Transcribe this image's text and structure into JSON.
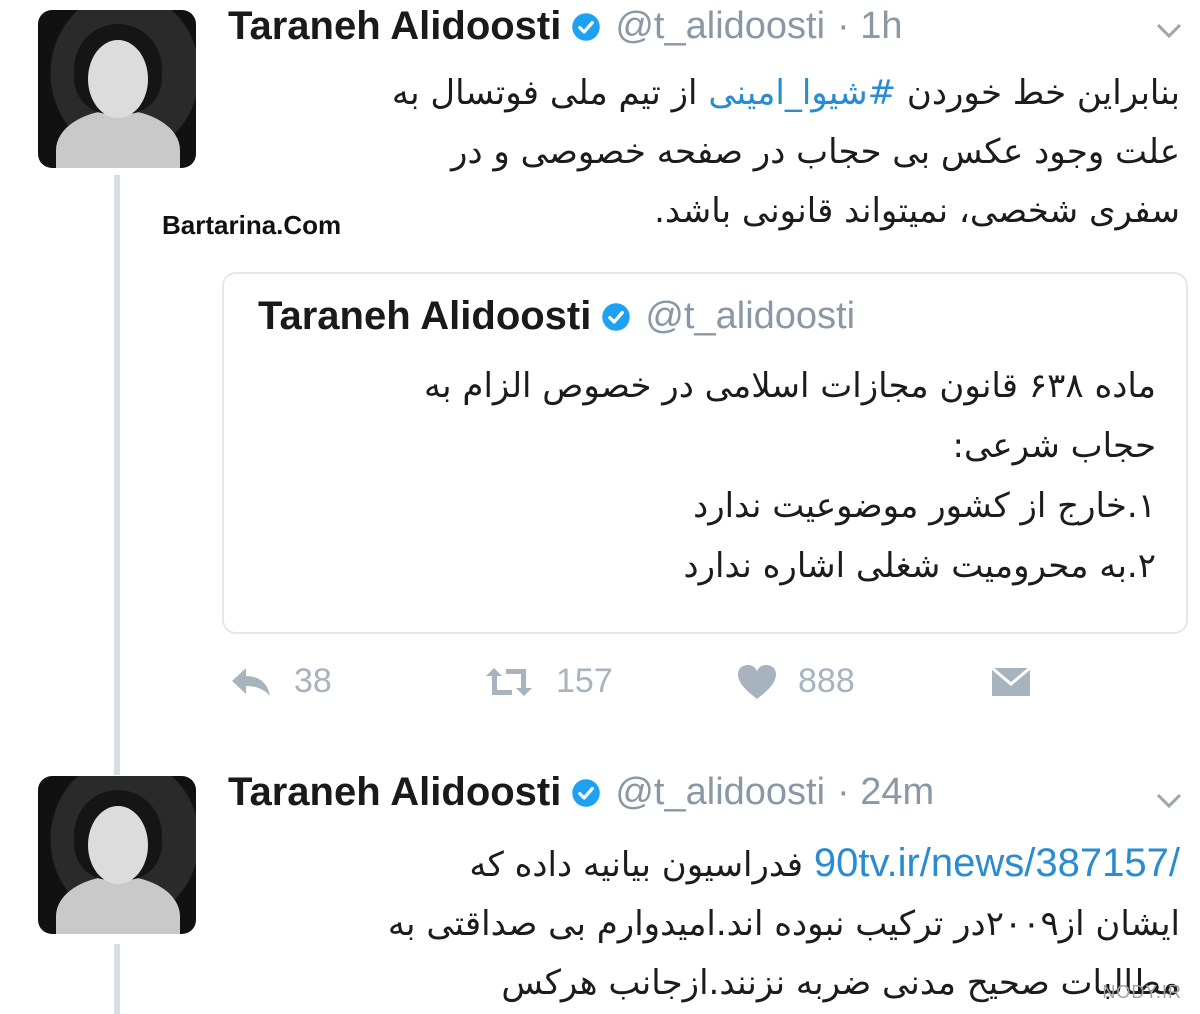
{
  "tweet1": {
    "name": "Taraneh Alidoosti",
    "handle": "@t_alidoosti",
    "time": "· 1h",
    "lines": [
      {
        "before": "بنابراین خط خوردن ",
        "hashtag": "#شیوا_امینی",
        "after": " از تیم ملی فوتسال به"
      },
      {
        "text": "علت وجود عکس بی حجاب در صفحه خصوصی و در"
      },
      {
        "text": "سفری شخصی، نمیتواند قانونی باشد."
      }
    ],
    "watermark": "Bartarina.Com"
  },
  "quoted": {
    "name": "Taraneh Alidoosti",
    "handle": "@t_alidoosti",
    "lines": [
      "ماده ۶۳۸ قانون مجازات اسلامی در خصوص الزام به",
      "حجاب شرعی:",
      "۱.خارج از کشور موضوعیت ندارد",
      "۲.به محرومیت شغلی اشاره ندارد"
    ]
  },
  "actions": {
    "reply_count": "38",
    "retweet_count": "157",
    "like_count": "888"
  },
  "tweet2": {
    "name": "Taraneh Alidoosti",
    "handle": "@t_alidoosti",
    "time": "· 24m",
    "link": "90tv.ir/news/387157/",
    "line1_after_link": "فدراسیون بیانیه داده که",
    "lines": [
      "ایشان از۲۰۰۹در ترکیب نبوده اند.امیدوارم بی صداقتی به",
      "مطالبات صحیح مدنی ضربه نزنند.ازجانب هرکس"
    ]
  },
  "site_mark": "NODY.IR",
  "colors": {
    "link": "#2a8bd1",
    "handle": "#8a98a5",
    "verified": "#1da1f2",
    "action": "#a7b3bd"
  }
}
